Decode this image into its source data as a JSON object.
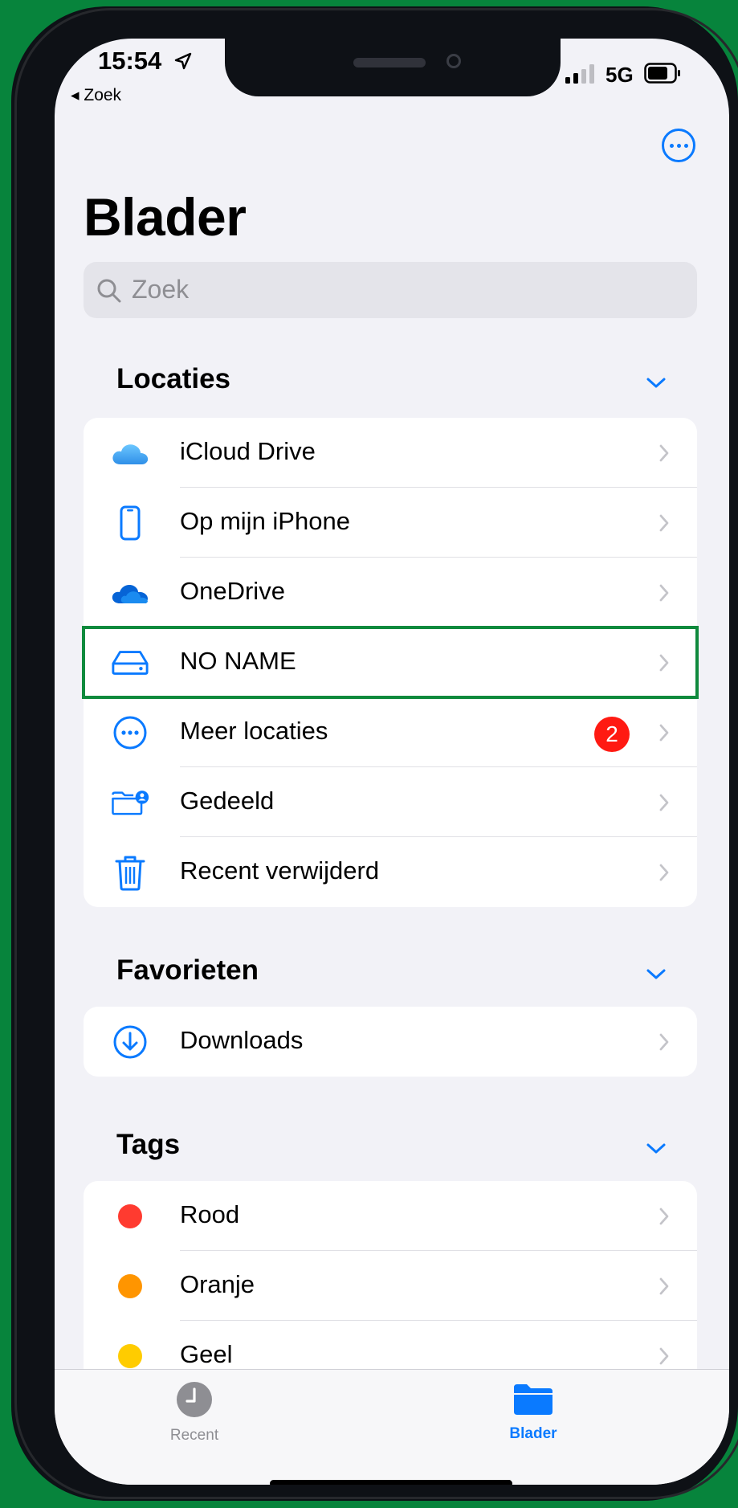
{
  "status_bar": {
    "time": "15:54",
    "back_app": "◂ Zoek",
    "network": "5G"
  },
  "header": {
    "title": "Blader",
    "more_icon": "ellipsis-circle-icon"
  },
  "search": {
    "placeholder": "Zoek"
  },
  "sections": {
    "locations": {
      "title": "Locaties",
      "items": [
        {
          "label": "iCloud Drive",
          "icon": "icloud-icon"
        },
        {
          "label": "Op mijn iPhone",
          "icon": "iphone-icon"
        },
        {
          "label": "OneDrive",
          "icon": "onedrive-icon"
        },
        {
          "label": "NO NAME",
          "icon": "external-drive-icon",
          "highlighted": true
        },
        {
          "label": "Meer locaties",
          "icon": "ellipsis-circle-icon",
          "badge": "2"
        },
        {
          "label": "Gedeeld",
          "icon": "shared-folder-icon"
        },
        {
          "label": "Recent verwijderd",
          "icon": "trash-icon"
        }
      ]
    },
    "favorites": {
      "title": "Favorieten",
      "items": [
        {
          "label": "Downloads",
          "icon": "download-circle-icon"
        }
      ]
    },
    "tags": {
      "title": "Tags",
      "items": [
        {
          "label": "Rood",
          "color": "#ff3b30"
        },
        {
          "label": "Oranje",
          "color": "#ff9500"
        },
        {
          "label": "Geel",
          "color": "#ffcc00"
        }
      ]
    }
  },
  "tabbar": {
    "tabs": [
      {
        "label": "Recent",
        "icon": "clock-icon",
        "active": false
      },
      {
        "label": "Blader",
        "icon": "folder-icon",
        "active": true
      }
    ]
  },
  "colors": {
    "accent": "#0a7aff",
    "background": "#07843c",
    "badge": "#ff1a12",
    "highlight_border": "#0f8a3d"
  }
}
